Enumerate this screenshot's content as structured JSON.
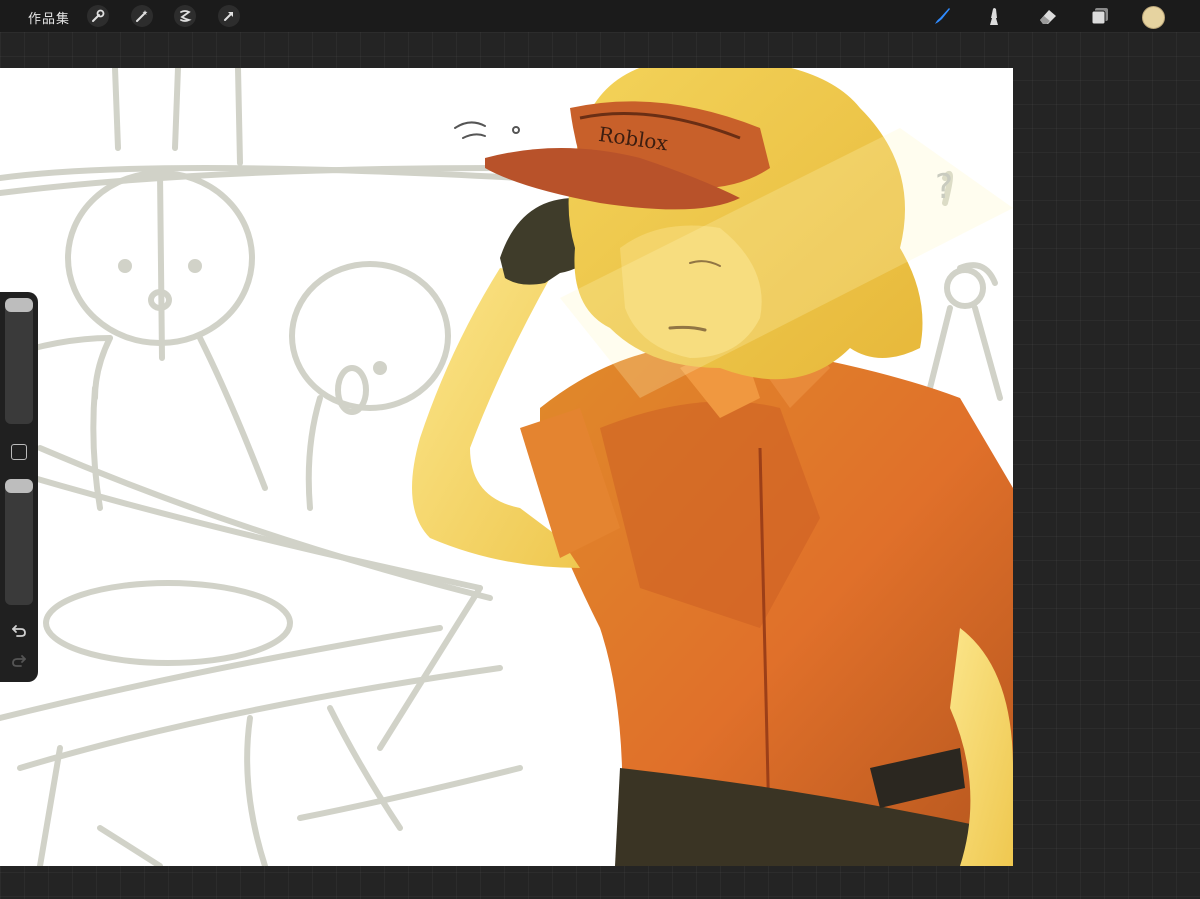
{
  "app": {
    "gallery_label": "作品集"
  },
  "toolbar_left": {
    "icons": [
      "wrench-icon",
      "magic-wand-icon",
      "selection-icon",
      "transform-arrow-icon"
    ]
  },
  "toolbar_right": {
    "icons": [
      "brush-icon",
      "smudge-icon",
      "eraser-icon",
      "layers-icon"
    ],
    "active_tool": "brush",
    "active_tool_color": "#2f8bff",
    "current_color": "#e6d3a0"
  },
  "sidebar": {
    "brush_size_fraction": 1.0,
    "opacity_fraction": 1.0,
    "icons": [
      "modify-square-icon",
      "undo-icon",
      "redo-icon"
    ]
  },
  "artwork": {
    "cap_text": "Roblox",
    "question_mark": "?"
  }
}
